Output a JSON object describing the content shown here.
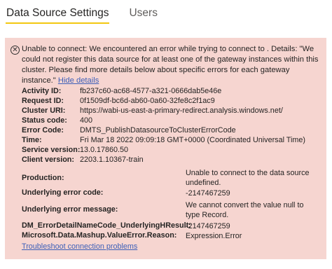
{
  "tabs": [
    {
      "label": "Data Source Settings",
      "active": true
    },
    {
      "label": "Users",
      "active": false
    }
  ],
  "error": {
    "icon": "error-circle-icon",
    "message": "Unable to connect: We encountered an error while trying to connect to . Details: \"We could not register this data source for at least one of the gateway instances within this cluster. Please find more details below about specific errors for each gateway instance.\"",
    "hide_details_label": "Hide details",
    "details": [
      {
        "key": "Activity ID:",
        "value": "fb237c60-ac68-4577-a321-0666dab5e46e"
      },
      {
        "key": "Request ID:",
        "value": "0f1509df-bc6d-ab60-0a60-32fe8c2f1ac9"
      },
      {
        "key": "Cluster URI:",
        "value": "https://wabi-us-east-a-primary-redirect.analysis.windows.net/"
      },
      {
        "key": "Status code:",
        "value": "400"
      },
      {
        "key": "Error Code:",
        "value": "DMTS_PublishDatasourceToClusterErrorCode"
      },
      {
        "key": "Time:",
        "value": "Fri Mar 18 2022 09:09:18 GMT+0000 (Coordinated Universal Time)"
      },
      {
        "key": "Service version:",
        "value": "13.0.17860.50"
      },
      {
        "key": "Client version:",
        "value": "2203.1.10367-train"
      }
    ],
    "gateway_details": [
      {
        "key": "Production:",
        "value": "Unable to connect to the data source undefined."
      },
      {
        "key": "Underlying error code:",
        "value": "-2147467259"
      },
      {
        "key": "Underlying error message:",
        "value": "We cannot convert the value null to type Record."
      },
      {
        "key": "DM_ErrorDetailNameCode_UnderlyingHResult:",
        "value": "-2147467259"
      },
      {
        "key": "Microsoft.Data.Mashup.ValueError.Reason:",
        "value": "Expression.Error"
      }
    ],
    "troubleshoot_label": "Troubleshoot connection problems"
  },
  "colors": {
    "panel_bg": "#f6d5d0",
    "tab_accent": "#f2c811",
    "link": "#3d5fb8"
  }
}
